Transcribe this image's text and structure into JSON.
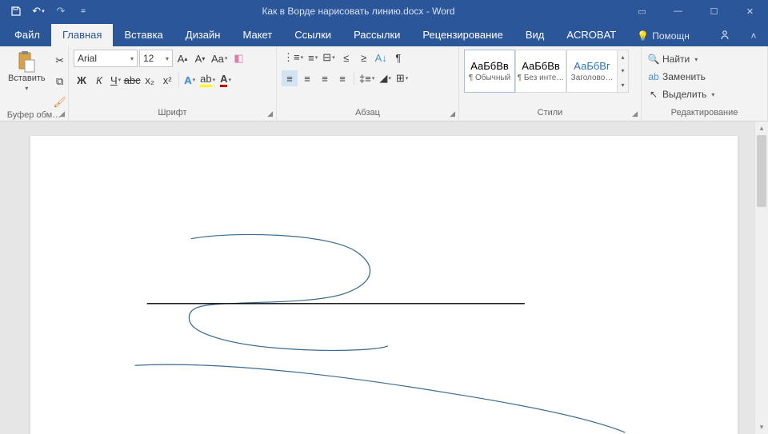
{
  "titlebar": {
    "title": "Как в Ворде нарисовать линию.docx - Word"
  },
  "tabs": {
    "file": "Файл",
    "home": "Главная",
    "insert": "Вставка",
    "design": "Дизайн",
    "layout": "Макет",
    "references": "Ссылки",
    "mailings": "Рассылки",
    "review": "Рецензирование",
    "view": "Вид",
    "acrobat": "ACROBAT",
    "tellme": "Помощн"
  },
  "ribbon": {
    "clipboard": {
      "paste": "Вставить",
      "label": "Буфер обм…"
    },
    "font": {
      "name": "Arial",
      "size": "12",
      "bold": "Ж",
      "italic": "К",
      "underline": "Ч",
      "strike": "abc",
      "subscript": "x₂",
      "superscript": "x²",
      "label": "Шрифт"
    },
    "paragraph": {
      "label": "Абзац"
    },
    "styles": {
      "normal_preview": "АаБбВв",
      "normal": "¶ Обычный",
      "nospacing_preview": "АаБбВв",
      "nospacing": "¶ Без инте…",
      "heading1_preview": "АаБбВг",
      "heading1": "Заголово…",
      "label": "Стили"
    },
    "editing": {
      "find": "Найти",
      "replace": "Заменить",
      "select": "Выделить",
      "label": "Редактирование"
    }
  }
}
